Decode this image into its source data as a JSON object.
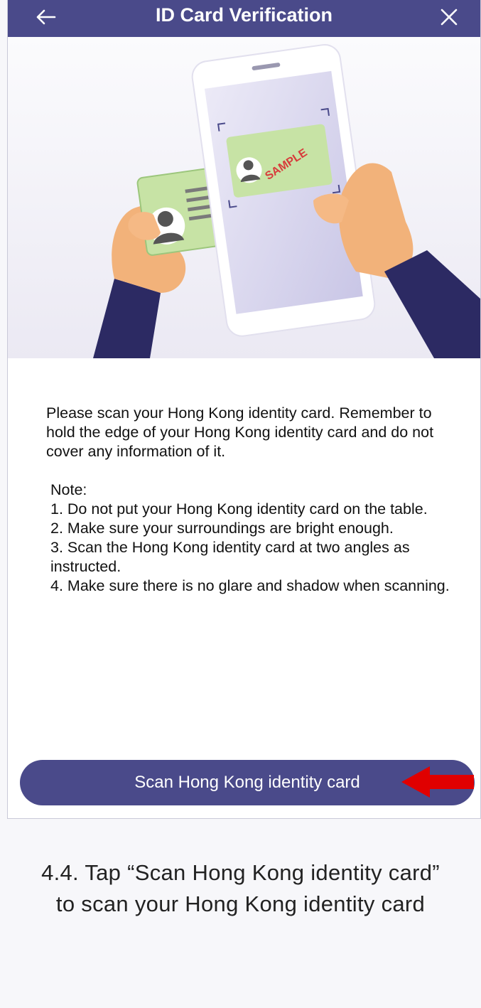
{
  "header": {
    "title": "ID Card Verification",
    "back_icon": "arrow-left-icon",
    "close_icon": "close-icon"
  },
  "illustration": {
    "description_icon": "hand-scanning-id-card-illustration",
    "watermark_text": "SAMPLE"
  },
  "instructions": {
    "intro": "Please scan your Hong Kong identity card. Remember to hold the edge of your Hong Kong identity card and do not cover any information of it.",
    "note_title": "Note:",
    "notes": [
      "1. Do not put your Hong Kong identity card on the table.",
      "2. Make sure your surroundings are bright enough.",
      "3. Scan the Hong Kong identity card at two angles as instructed.",
      "4. Make sure there is no glare and shadow when scanning."
    ]
  },
  "button": {
    "label": "Scan Hong Kong identity card"
  },
  "caption": {
    "line1": "4.4. Tap “Scan Hong Kong identity card”",
    "line2": "to scan your Hong Kong identity card"
  },
  "colors": {
    "primary": "#4a4a8a",
    "arrow": "#e00000",
    "background": "#f7f7fa"
  }
}
